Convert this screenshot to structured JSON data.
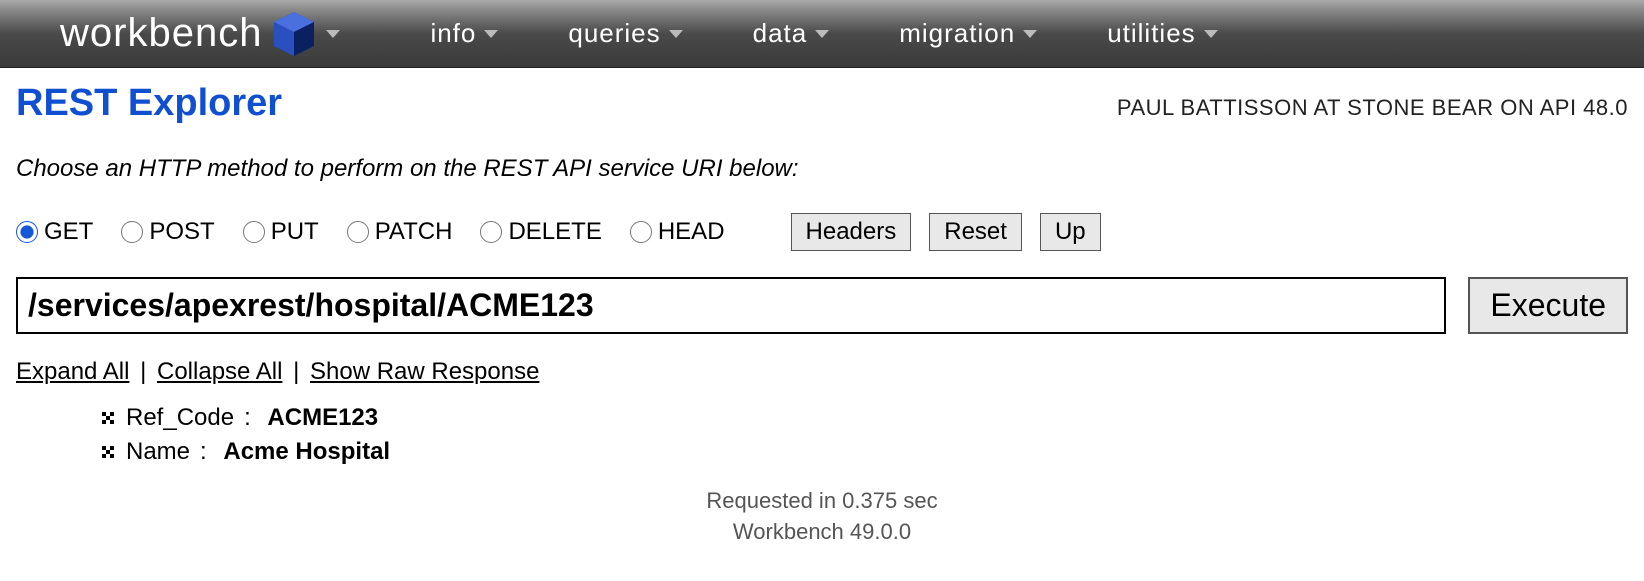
{
  "nav": {
    "logo_text": "workbench",
    "items": [
      "info",
      "queries",
      "data",
      "migration",
      "utilities"
    ]
  },
  "page": {
    "title": "REST Explorer",
    "user_context": "PAUL BATTISSON AT STONE BEAR ON API 48.0",
    "instruction": "Choose an HTTP method to perform on the REST API service URI below:"
  },
  "methods": {
    "options": [
      "GET",
      "POST",
      "PUT",
      "PATCH",
      "DELETE",
      "HEAD"
    ],
    "selected": "GET"
  },
  "buttons": {
    "headers": "Headers",
    "reset": "Reset",
    "up": "Up",
    "execute": "Execute"
  },
  "uri": {
    "value": "/services/apexrest/hospital/ACME123"
  },
  "links": {
    "expand_all": "Expand All",
    "collapse_all": "Collapse All",
    "show_raw": "Show Raw Response"
  },
  "response": {
    "fields": [
      {
        "key": "Ref_Code",
        "value": "ACME123"
      },
      {
        "key": "Name",
        "value": "Acme Hospital"
      }
    ]
  },
  "footer": {
    "timing": "Requested in 0.375 sec",
    "version": "Workbench 49.0.0"
  }
}
